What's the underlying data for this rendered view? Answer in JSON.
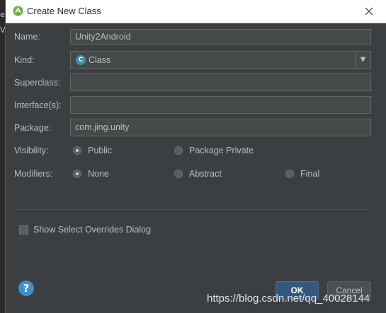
{
  "background": {
    "fragment_top": "e",
    "fragment_bottom": "V"
  },
  "dialog": {
    "title": "Create New Class",
    "title_icon": "android-studio-icon",
    "close_icon": "close-icon"
  },
  "form": {
    "name": {
      "label": "Name:",
      "value": "Unity2Android"
    },
    "kind": {
      "label": "Kind:",
      "value": "Class",
      "icon": "class-c-icon",
      "icon_glyph": "C",
      "arrow": "▼"
    },
    "superclass": {
      "label": "Superclass:",
      "value": ""
    },
    "interfaces": {
      "label": "Interface(s):",
      "value": ""
    },
    "package": {
      "label": "Package:",
      "value": "com.jing.unity"
    },
    "visibility": {
      "label": "Visibility:",
      "options": [
        "Public",
        "Package Private"
      ],
      "selected": "Public"
    },
    "modifiers": {
      "label": "Modifiers:",
      "options": [
        "None",
        "Abstract",
        "Final"
      ],
      "selected": "None"
    },
    "show_overrides": {
      "label": "Show Select Overrides Dialog",
      "checked": false
    }
  },
  "footer": {
    "help_glyph": "?",
    "ok_label": "OK",
    "cancel_label": "Cancel"
  },
  "watermark": "https://blog.csdn.net/qq_40028144",
  "colors": {
    "dialog_bg": "#3c3f41",
    "field_bg": "#45494a",
    "text": "#bbbbbb",
    "ok_button": "#365880",
    "help_blue": "#3f8fd0",
    "class_icon": "#3d8fa6"
  }
}
